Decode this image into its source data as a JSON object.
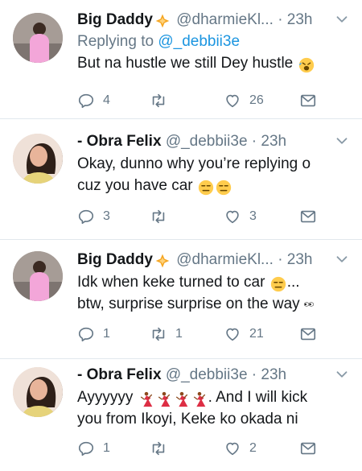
{
  "tweets": [
    {
      "name": "Big Daddy",
      "handle": "@dharmieKl...",
      "sep": "·",
      "time": "23h",
      "reply_prefix": "Replying to ",
      "reply_to": "@_debbii3e",
      "text": "But na hustle we still Dey hustle",
      "counts": {
        "replies": "4",
        "retweets": "",
        "likes": "26"
      }
    },
    {
      "name": "- Obra Felix",
      "handle": "@_debbii3e",
      "sep": "·",
      "time": "23h",
      "text_line1": "Okay, dunno why you’re replying o",
      "text_line2": "cuz you have car",
      "counts": {
        "replies": "3",
        "retweets": "",
        "likes": "3"
      }
    },
    {
      "name": "Big Daddy",
      "handle": "@dharmieKl...",
      "sep": "·",
      "time": "23h",
      "text_line1": "Idk when keke turned to car",
      "text_line1_suffix": "...",
      "text_line2": "btw, surprise surprise on the way",
      "counts": {
        "replies": "1",
        "retweets": "1",
        "likes": "21"
      }
    },
    {
      "name": "- Obra Felix",
      "handle": "@_debbii3e",
      "sep": "·",
      "time": "23h",
      "text_line1_a": "Ayyyyyy",
      "text_line1_b": ". And I will kick",
      "text_line2": "you from Ikoyi, Keke ko okada ni",
      "counts": {
        "replies": "1",
        "retweets": "",
        "likes": "2"
      }
    }
  ],
  "icons": {
    "reply": "reply-icon",
    "retweet": "retweet-icon",
    "like": "heart-icon",
    "dm": "envelope-icon",
    "menu": "chevron-down-icon"
  },
  "colors": {
    "link": "#1b95e0",
    "muted": "#657786",
    "verified_badge": "#f5a623"
  }
}
